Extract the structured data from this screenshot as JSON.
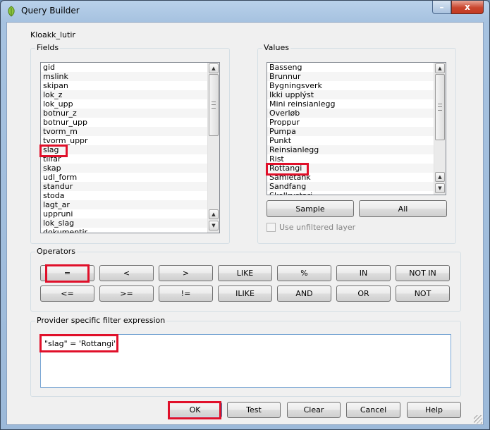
{
  "window": {
    "title": "Query Builder",
    "minimize_glyph": "–",
    "close_glyph": "x"
  },
  "layer_name": "Kloakk_lutir",
  "fields": {
    "label": "Fields",
    "items": [
      "gid",
      "mslink",
      "skipan",
      "lok_z",
      "lok_upp",
      "botnur_z",
      "botnur_upp",
      "tvorm_m",
      "tvorm_uppr",
      "slag",
      "tilfar",
      "skap",
      "udl_form",
      "standur",
      "stoda",
      "lagt_ar",
      "uppruni",
      "lok_slag",
      "dokumentir"
    ],
    "highlighted": "slag"
  },
  "values": {
    "label": "Values",
    "items": [
      "Basseng",
      "Brunnur",
      "Bygningsverk",
      "Ikki upplýst",
      "Mini reinsianlegg",
      "Overløb",
      "Proppur",
      "Pumpa",
      "Punkt",
      "Reinsianlegg",
      "Rist",
      "Rottangi",
      "Samletank",
      "Sandfang",
      "Skellrystari"
    ],
    "highlighted": "Rottangi",
    "sample_label": "Sample",
    "all_label": "All",
    "unfiltered_label": "Use unfiltered layer"
  },
  "operators": {
    "label": "Operators",
    "row1": [
      "=",
      "<",
      ">",
      "LIKE",
      "%",
      "IN",
      "NOT IN"
    ],
    "row2": [
      "<=",
      ">=",
      "!=",
      "ILIKE",
      "AND",
      "OR",
      "NOT"
    ],
    "highlighted": "="
  },
  "filter": {
    "label": "Provider specific filter expression",
    "expression": "\"slag\" = 'Rottangi'"
  },
  "buttons": {
    "ok": "OK",
    "test": "Test",
    "clear": "Clear",
    "cancel": "Cancel",
    "help": "Help"
  },
  "colors": {
    "highlight_box": "#e0102a",
    "titlebar": "#a6c2e0",
    "close_button": "#c9462e"
  }
}
